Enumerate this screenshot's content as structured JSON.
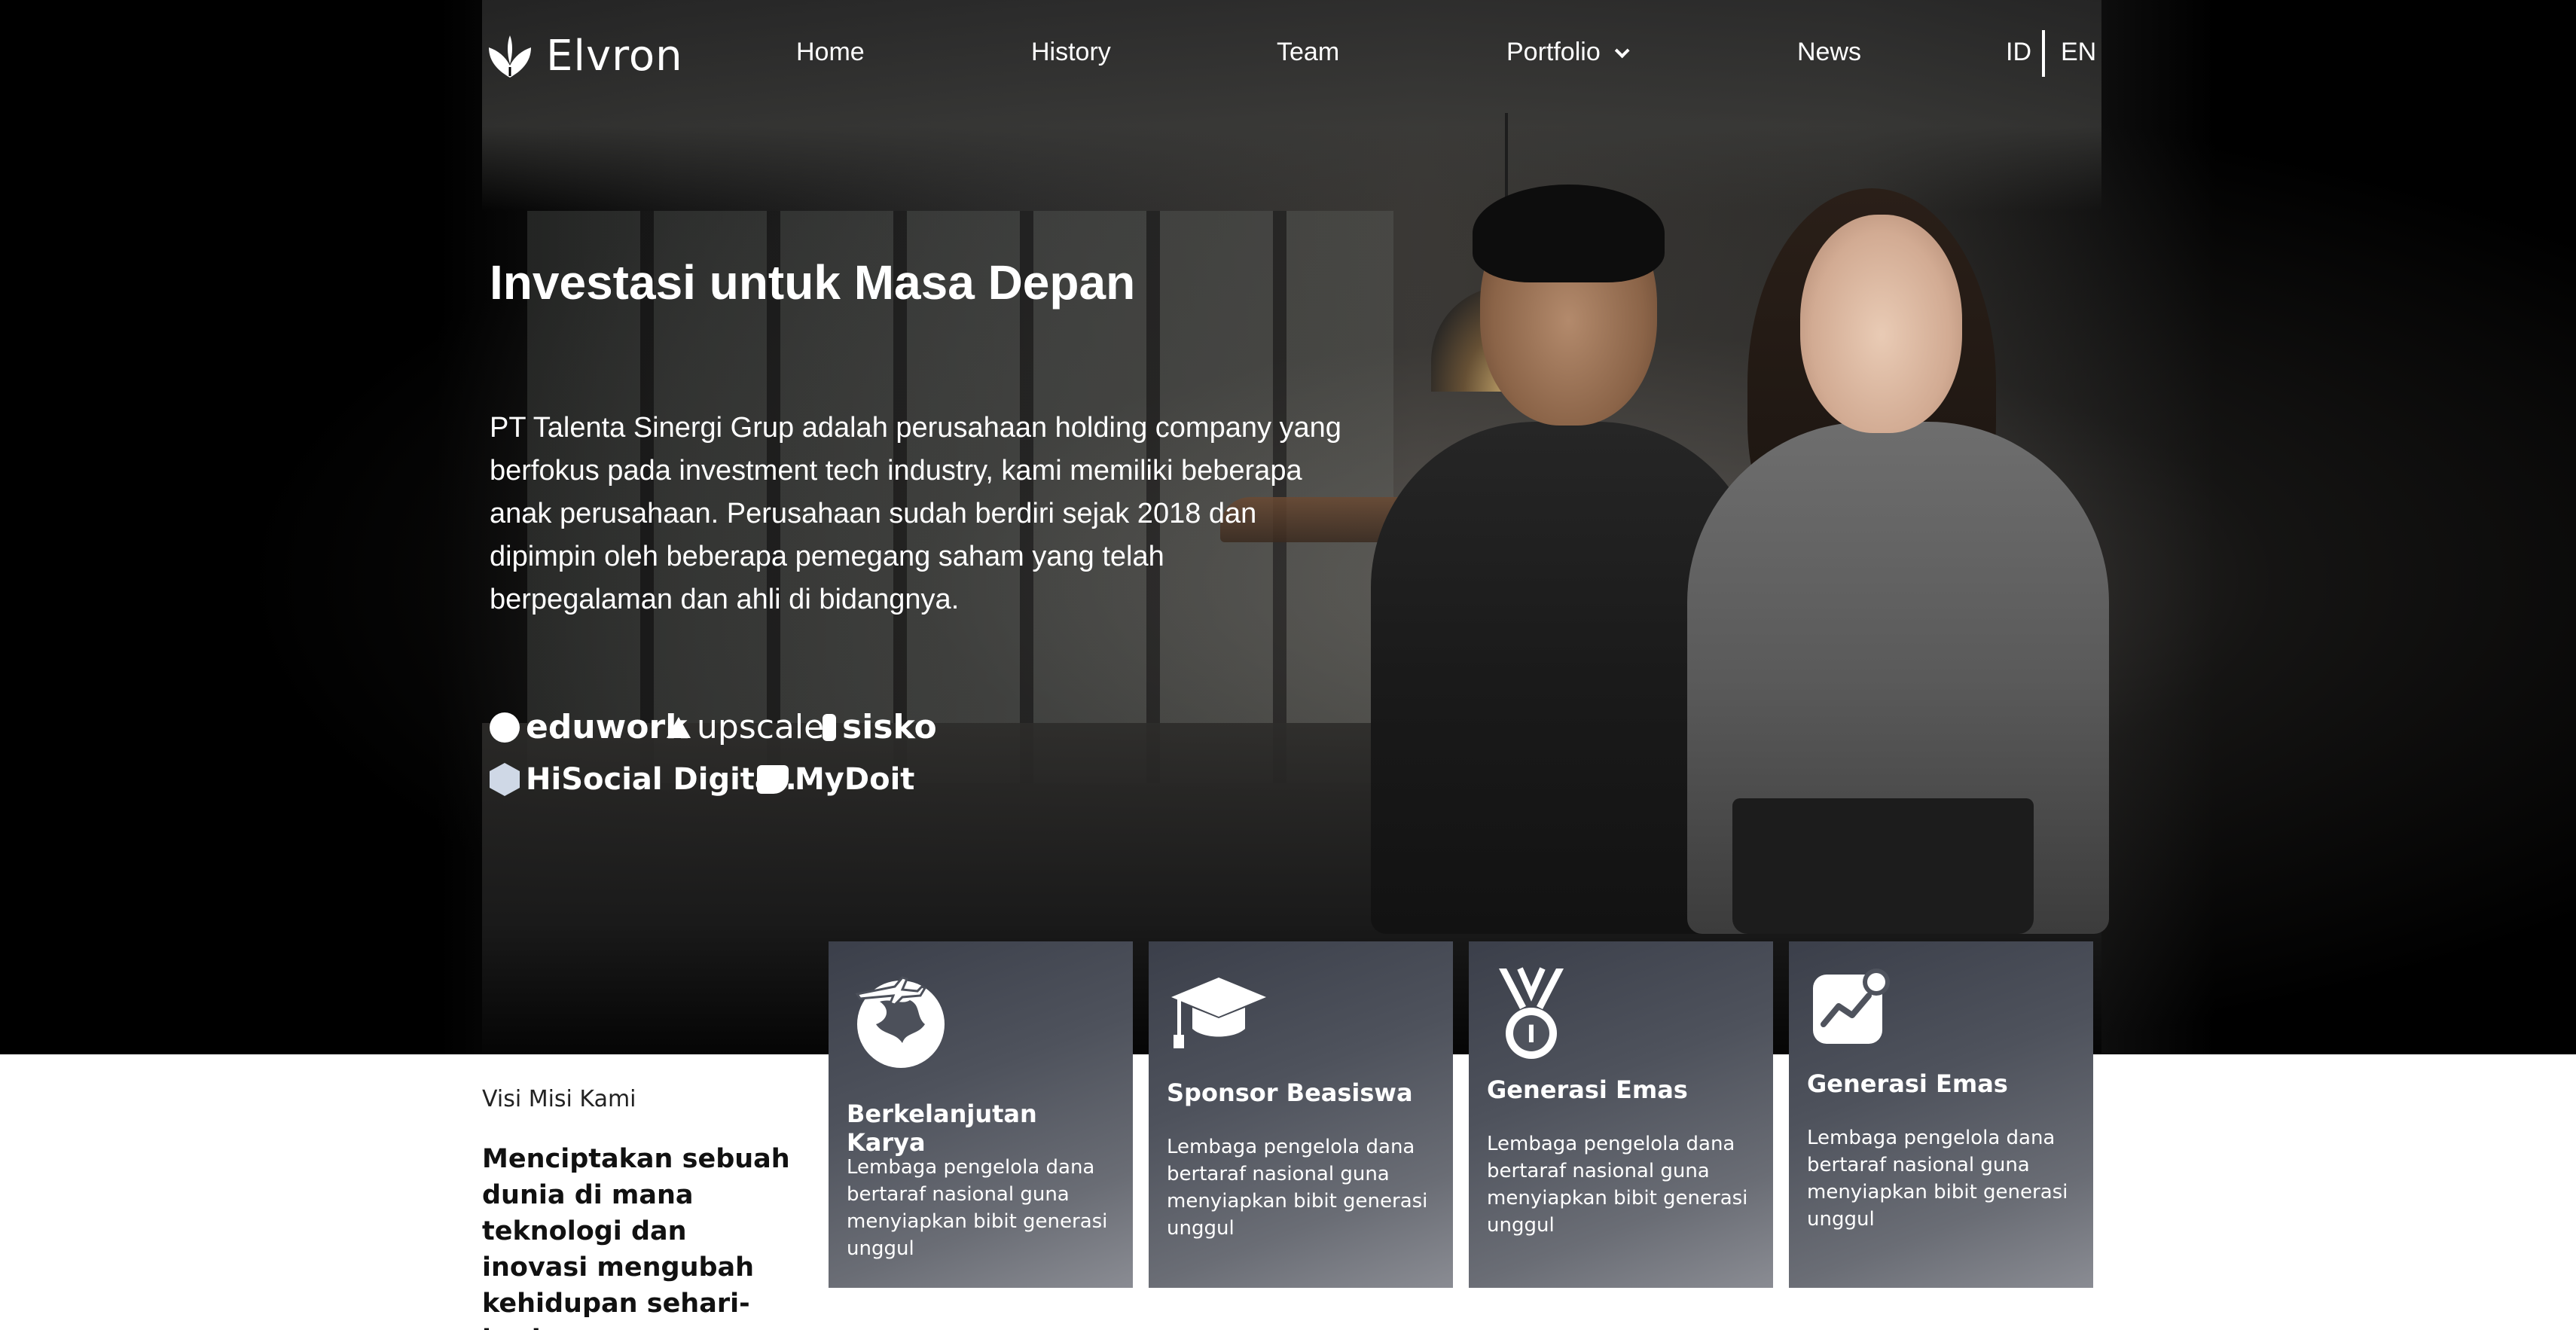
{
  "brand": {
    "name": "Elvron"
  },
  "nav": {
    "items": [
      {
        "label": "Home"
      },
      {
        "label": "History"
      },
      {
        "label": "Team"
      },
      {
        "label": "Portfolio"
      },
      {
        "label": "News"
      }
    ],
    "languages": [
      "ID",
      "EN"
    ]
  },
  "hero": {
    "title": "Investasi untuk Masa Depan",
    "description": "PT Talenta Sinergi Grup adalah perusahaan holding company yang berfokus pada investment tech industry, kami memiliki beberapa anak perusahaan. Perusahaan sudah berdiri sejak 2018 dan dipimpin oleh beberapa pemegang saham yang telah berpegalaman dan ahli di bidangnya.",
    "partners": [
      "eduwork",
      "upscale",
      "sisko",
      "HiSocial Digital.",
      "MyDoit"
    ]
  },
  "visi_misi": {
    "label": "Visi Misi Kami",
    "statement": "Menciptakan sebuah dunia di mana teknologi dan inovasi mengubah kehidupan sehari-hari."
  },
  "cards": [
    {
      "icon": "globe-plane-icon",
      "title": "Berkelanjutan Karya",
      "text": "Lembaga pengelola dana bertaraf nasional guna menyiapkan bibit generasi unggul"
    },
    {
      "icon": "graduation-cap-icon",
      "title": "Sponsor Beasiswa",
      "text": "Lembaga pengelola dana bertaraf nasional guna menyiapkan bibit generasi unggul"
    },
    {
      "icon": "medal-icon",
      "title": "Generasi Emas",
      "text": "Lembaga pengelola dana bertaraf nasional guna menyiapkan bibit generasi unggul"
    },
    {
      "icon": "growth-chart-icon",
      "title": "Generasi Emas",
      "text": "Lembaga pengelola dana bertaraf nasional guna menyiapkan bibit generasi unggul"
    }
  ]
}
